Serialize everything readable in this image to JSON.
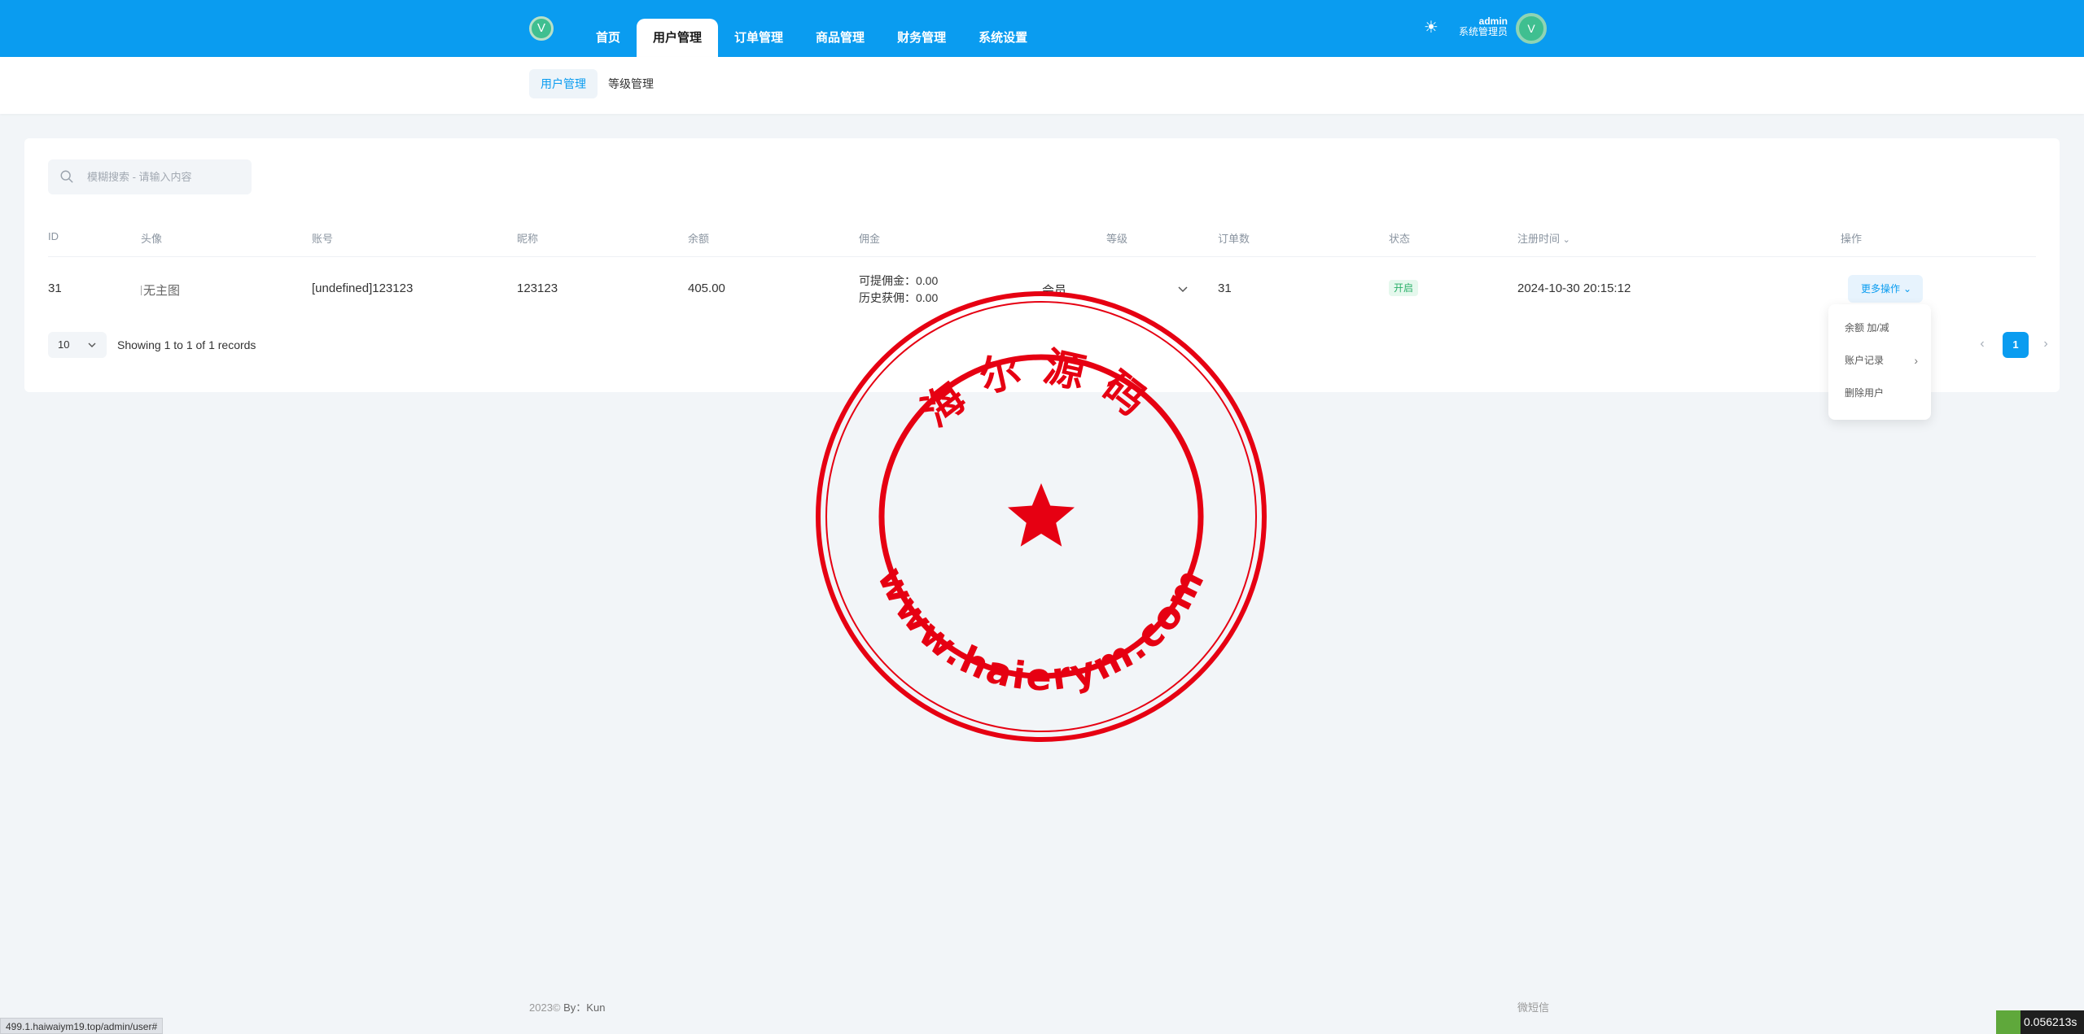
{
  "header": {
    "logo_text": "V",
    "nav": [
      "首页",
      "用户管理",
      "订单管理",
      "商品管理",
      "财务管理",
      "系统设置"
    ],
    "active_nav": 1,
    "user_name": "admin",
    "user_role": "系统管理员",
    "avatar_text": "V"
  },
  "subnav": {
    "tabs": [
      "用户管理",
      "等级管理"
    ],
    "active": 0
  },
  "search": {
    "placeholder": "模糊搜索 - 请输入内容"
  },
  "table": {
    "columns": {
      "id": "ID",
      "avatar": "头像",
      "account": "账号",
      "nickname": "昵称",
      "balance": "余额",
      "commission": "佣金",
      "level": "等级",
      "orders": "订单数",
      "status": "状态",
      "reg_time": "注册时间",
      "actions": "操作"
    },
    "row": {
      "id": "31",
      "avatar_alt": "无主图",
      "account": "[undefined]123123",
      "nickname": "123123",
      "balance": "405.00",
      "commission_avail": "可提佣金：0.00",
      "commission_hist": "历史获佣：0.00",
      "level": "会员",
      "orders": "31",
      "status": "开启",
      "reg_time": "2024-10-30 20:15:12",
      "more_btn": "更多操作"
    }
  },
  "dropdown": {
    "items": [
      "余额 加/减",
      "账户记录",
      "删除用户"
    ]
  },
  "pagination": {
    "page_size": "10",
    "records_text": "Showing 1 to 1 of 1 records",
    "current_page": "1"
  },
  "watermark": {
    "top_text": "海尔源码",
    "bottom_text": "www.haierym.com",
    "color": "#e60012"
  },
  "footer": {
    "copyright": "2023©",
    "by": "By：Kun",
    "right": "微短信"
  },
  "statusbar": {
    "url": "499.1.haiwaiym19.top/admin/user#",
    "timer": "0.056213s"
  },
  "colors": {
    "primary": "#0a9cf0",
    "success": "#2bb06a"
  }
}
